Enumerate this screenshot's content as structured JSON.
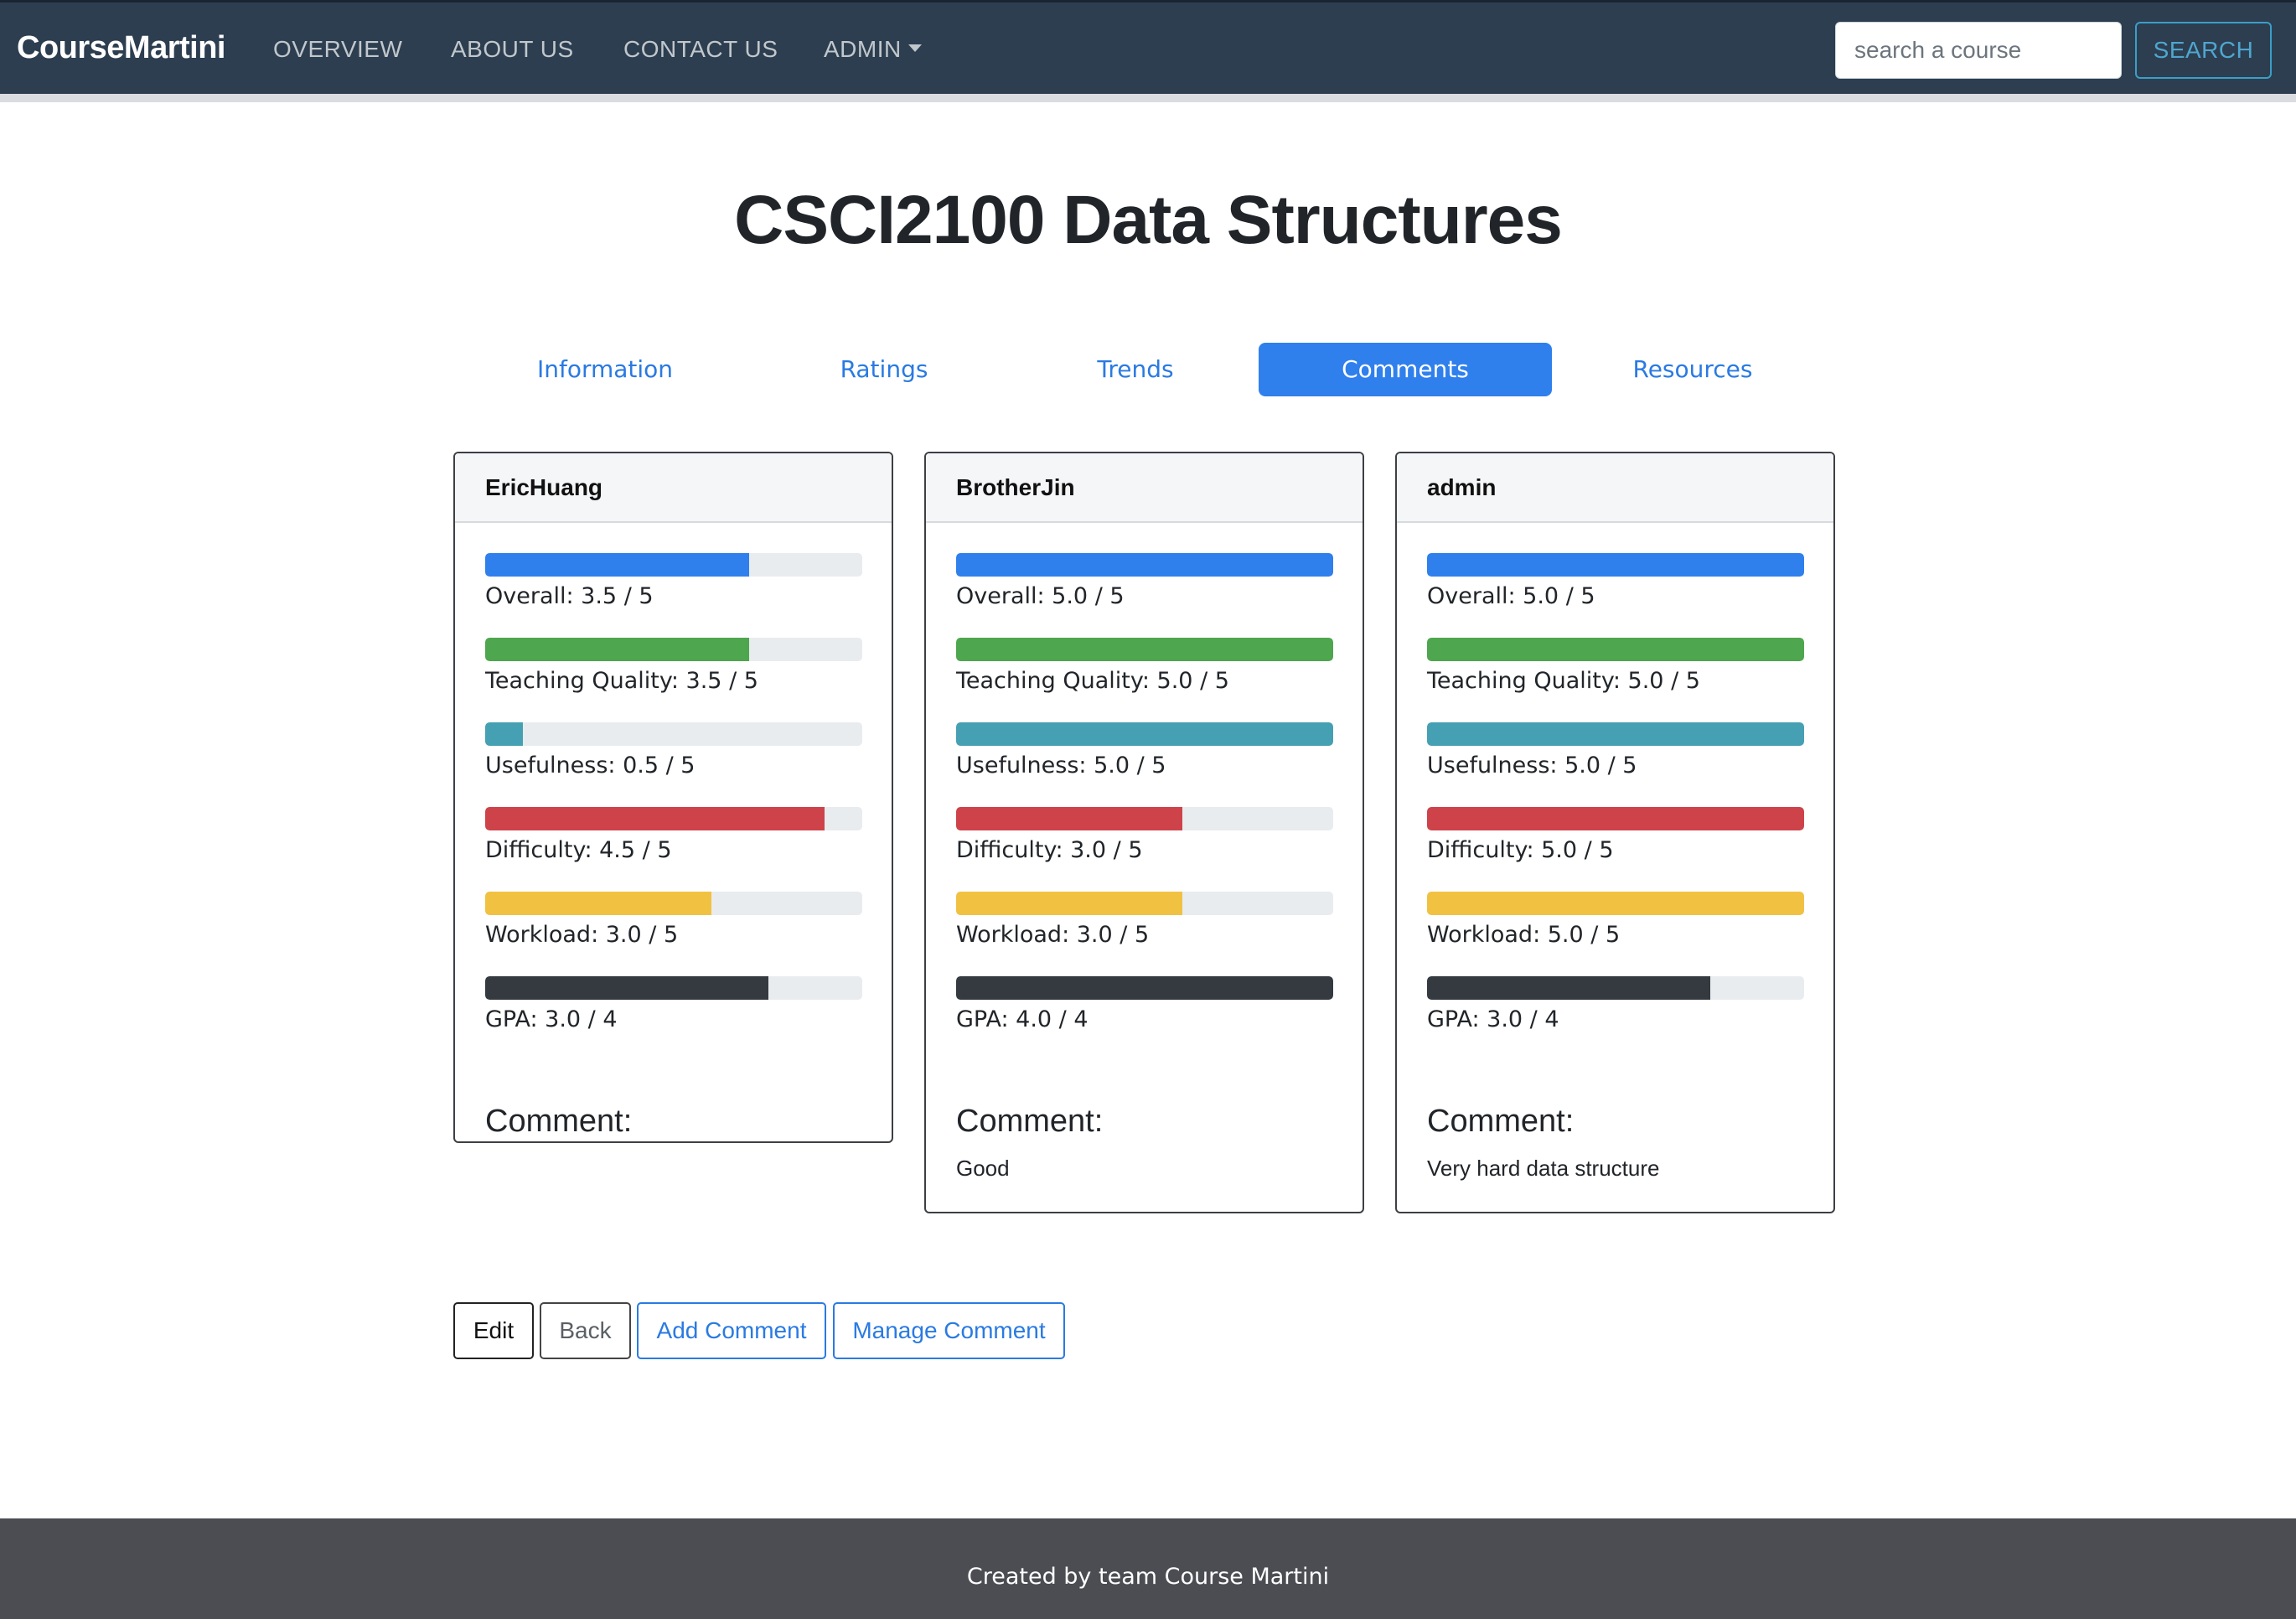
{
  "navbar": {
    "brand": "CourseMartini",
    "links": [
      {
        "label": "OVERVIEW"
      },
      {
        "label": "ABOUT US"
      },
      {
        "label": "CONTACT US"
      },
      {
        "label": "ADMIN"
      }
    ],
    "search_placeholder": "search a course",
    "search_label": "SEARCH"
  },
  "page": {
    "title": "CSCI2100 Data Structures"
  },
  "tabs": [
    {
      "label": "Information",
      "active": false
    },
    {
      "label": "Ratings",
      "active": false
    },
    {
      "label": "Trends",
      "active": false
    },
    {
      "label": "Comments",
      "active": true
    },
    {
      "label": "Resources",
      "active": false
    }
  ],
  "metric_colors": {
    "overall": "#2f80ed",
    "teaching_quality": "#4ea64e",
    "usefulness": "#46a0b3",
    "difficulty": "#cd4349",
    "workload": "#f1c142",
    "gpa": "#343a40"
  },
  "comments": [
    {
      "user": "EricHuang",
      "metrics": [
        {
          "key": "overall",
          "label": "Overall: 3.5 / 5",
          "fraction": 0.7
        },
        {
          "key": "teaching_quality",
          "label": "Teaching Quality: 3.5 / 5",
          "fraction": 0.7
        },
        {
          "key": "usefulness",
          "label": "Usefulness: 0.5 / 5",
          "fraction": 0.1
        },
        {
          "key": "difficulty",
          "label": "Difficulty: 4.5 / 5",
          "fraction": 0.9
        },
        {
          "key": "workload",
          "label": "Workload: 3.0 / 5",
          "fraction": 0.6
        },
        {
          "key": "gpa",
          "label": "GPA: 3.0 / 4",
          "fraction": 0.75
        }
      ],
      "comment_heading": "Comment:",
      "comment_text": ""
    },
    {
      "user": "BrotherJin",
      "metrics": [
        {
          "key": "overall",
          "label": "Overall: 5.0 / 5",
          "fraction": 1.0
        },
        {
          "key": "teaching_quality",
          "label": "Teaching Quality: 5.0 / 5",
          "fraction": 1.0
        },
        {
          "key": "usefulness",
          "label": "Usefulness: 5.0 / 5",
          "fraction": 1.0
        },
        {
          "key": "difficulty",
          "label": "Difficulty: 3.0 / 5",
          "fraction": 0.6
        },
        {
          "key": "workload",
          "label": "Workload: 3.0 / 5",
          "fraction": 0.6
        },
        {
          "key": "gpa",
          "label": "GPA: 4.0 / 4",
          "fraction": 1.0
        }
      ],
      "comment_heading": "Comment:",
      "comment_text": "Good"
    },
    {
      "user": "admin",
      "metrics": [
        {
          "key": "overall",
          "label": "Overall: 5.0 / 5",
          "fraction": 1.0
        },
        {
          "key": "teaching_quality",
          "label": "Teaching Quality: 5.0 / 5",
          "fraction": 1.0
        },
        {
          "key": "usefulness",
          "label": "Usefulness: 5.0 / 5",
          "fraction": 1.0
        },
        {
          "key": "difficulty",
          "label": "Difficulty: 5.0 / 5",
          "fraction": 1.0
        },
        {
          "key": "workload",
          "label": "Workload: 5.0 / 5",
          "fraction": 1.0
        },
        {
          "key": "gpa",
          "label": "GPA: 3.0 / 4",
          "fraction": 0.75
        }
      ],
      "comment_heading": "Comment:",
      "comment_text": "Very hard data structure"
    }
  ],
  "actions": {
    "edit": "Edit",
    "back": "Back",
    "add_comment": "Add Comment",
    "manage_comment": "Manage Comment"
  },
  "footer": {
    "text": "Created by team Course Martini"
  }
}
